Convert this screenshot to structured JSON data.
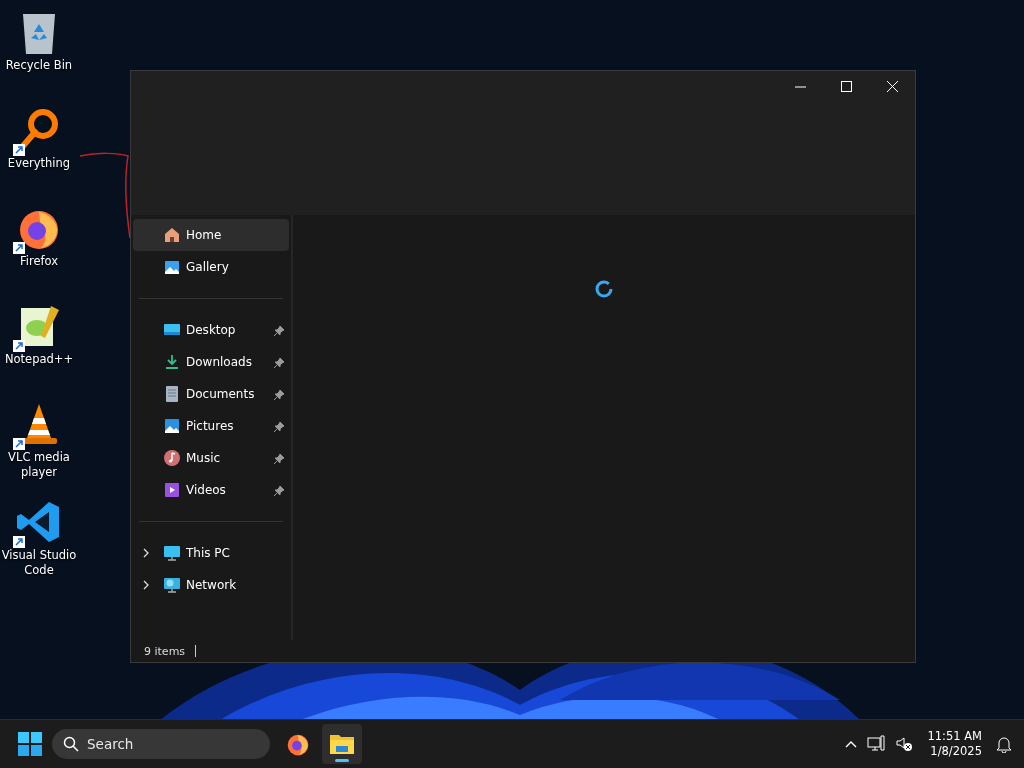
{
  "desktop_icons": [
    {
      "kind": "recycle",
      "label": "Recycle Bin",
      "shortcut": false
    },
    {
      "kind": "everything",
      "label": "Everything",
      "shortcut": true
    },
    {
      "kind": "firefox",
      "label": "Firefox",
      "shortcut": true
    },
    {
      "kind": "notepad",
      "label": "Notepad++",
      "shortcut": true
    },
    {
      "kind": "vlc",
      "label": "VLC media player",
      "shortcut": true
    },
    {
      "kind": "vscode",
      "label": "Visual Studio Code",
      "shortcut": true
    }
  ],
  "window": {
    "sidebar": {
      "groups": [
        [
          {
            "kind": "home",
            "label": "Home",
            "selected": true,
            "pinned": false,
            "expandable": false
          },
          {
            "kind": "gallery",
            "label": "Gallery",
            "selected": false,
            "pinned": false,
            "expandable": false
          }
        ],
        [
          {
            "kind": "desktop",
            "label": "Desktop",
            "selected": false,
            "pinned": true,
            "expandable": false
          },
          {
            "kind": "downloads",
            "label": "Downloads",
            "selected": false,
            "pinned": true,
            "expandable": false
          },
          {
            "kind": "documents",
            "label": "Documents",
            "selected": false,
            "pinned": true,
            "expandable": false
          },
          {
            "kind": "pictures",
            "label": "Pictures",
            "selected": false,
            "pinned": true,
            "expandable": false
          },
          {
            "kind": "music",
            "label": "Music",
            "selected": false,
            "pinned": true,
            "expandable": false
          },
          {
            "kind": "videos",
            "label": "Videos",
            "selected": false,
            "pinned": true,
            "expandable": false
          }
        ],
        [
          {
            "kind": "pc",
            "label": "This PC",
            "selected": false,
            "pinned": false,
            "expandable": true
          },
          {
            "kind": "network",
            "label": "Network",
            "selected": false,
            "pinned": false,
            "expandable": true
          }
        ]
      ]
    },
    "loading": true,
    "status_bar": {
      "items_count": "9 items"
    }
  },
  "taskbar": {
    "search": {
      "placeholder": "Search"
    },
    "apps": [
      {
        "kind": "firefox",
        "selected": false
      },
      {
        "kind": "explorer",
        "selected": true
      }
    ],
    "time": "11:51 AM",
    "date": "1/8/2025"
  }
}
